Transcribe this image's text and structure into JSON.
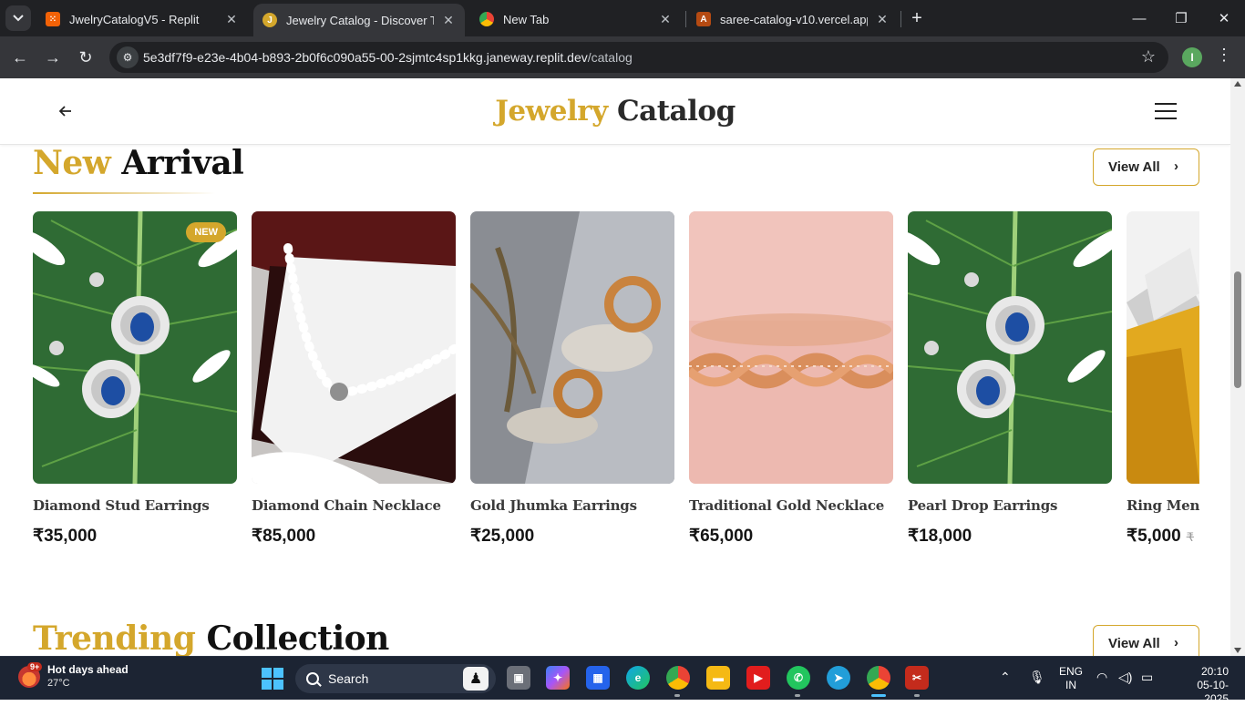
{
  "browser": {
    "tabs": [
      {
        "title": "JwelryCatalogV5 - Replit",
        "favicon": "replit-icon",
        "active": false
      },
      {
        "title": "Jewelry Catalog - Discover Time",
        "favicon": "jewelry-icon",
        "active": true
      },
      {
        "title": "New Tab",
        "favicon": "chrome-icon",
        "active": false
      },
      {
        "title": "saree-catalog-v10.vercel.app",
        "favicon": "vercel-icon",
        "active": false
      }
    ],
    "url_host": "5e3df7f9-e23e-4b04-b893-2b0f6c090a55-00-2sjmtc4sp1kkg.janeway.replit.dev",
    "url_path": "/catalog",
    "profile_initial": "I"
  },
  "header": {
    "logo_gold": "Jewelry",
    "logo_dark": "Catalog"
  },
  "new_arrival": {
    "title_gold": "New",
    "title_dark": "Arrival",
    "view_all": "View All",
    "products": [
      {
        "name": "Diamond Stud Earrings",
        "price": "₹35,000",
        "badge": "NEW",
        "image": "earrings-on-leaf"
      },
      {
        "name": "Diamond Chain Necklace",
        "price": "₹85,000",
        "image": "pearl-necklace-box"
      },
      {
        "name": "Gold Jhumka Earrings",
        "price": "₹25,000",
        "image": "gold-hoops-stone"
      },
      {
        "name": "Traditional Gold Necklace",
        "price": "₹65,000",
        "image": "rose-gold-bracelet"
      },
      {
        "name": "Pearl Drop Earrings",
        "price": "₹18,000",
        "image": "earrings-on-leaf"
      },
      {
        "name": "Ring Men",
        "price": "₹5,000",
        "old_price": "₹",
        "image": "diamond-ring-gold"
      }
    ]
  },
  "trending": {
    "title_gold": "Trending",
    "title_dark": "Collection",
    "view_all": "View All"
  },
  "taskbar": {
    "weather_title": "Hot days ahead",
    "weather_temp": "27°C",
    "weather_badge": "9+",
    "search_placeholder": "Search",
    "lang_1": "ENG",
    "lang_2": "IN",
    "time": "20:10",
    "date": "05-10-2025"
  },
  "colors": {
    "accent_gold": "#d4a72c",
    "text_dark": "#111111",
    "chrome_bg": "#202124"
  }
}
